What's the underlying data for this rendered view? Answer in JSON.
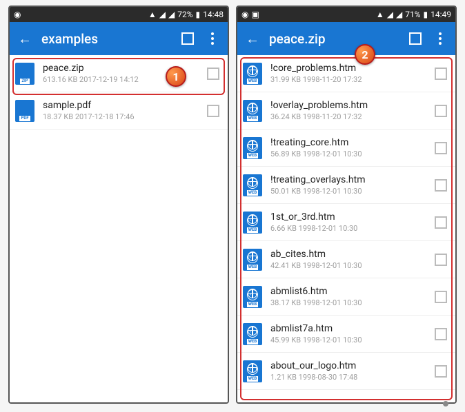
{
  "left": {
    "statusbar": {
      "battery": "72%",
      "time": "14:48"
    },
    "title": "examples",
    "files": [
      {
        "name": "peace.zip",
        "meta": "613.16 KB 2017-12-19 14:12",
        "ext": "ZIP"
      },
      {
        "name": "sample.pdf",
        "meta": "18.37 KB 2017-12-18 17:46",
        "ext": "PDF"
      }
    ],
    "badge": "1"
  },
  "right": {
    "statusbar": {
      "battery": "71%",
      "time": "14:49"
    },
    "title": "peace.zip",
    "files": [
      {
        "name": "!core_problems.htm",
        "meta": "31.99 KB 1998-11-20 17:32",
        "ext": "WEB"
      },
      {
        "name": "!overlay_problems.htm",
        "meta": "36.24 KB 1998-11-20 17:32",
        "ext": "WEB"
      },
      {
        "name": "!treating_core.htm",
        "meta": "56.89 KB 1998-12-01 10:30",
        "ext": "WEB"
      },
      {
        "name": "!treating_overlays.htm",
        "meta": "50.01 KB 1998-12-01 10:30",
        "ext": "WEB"
      },
      {
        "name": "1st_or_3rd.htm",
        "meta": "6.66 KB 1998-12-01 10:30",
        "ext": "WEB"
      },
      {
        "name": "ab_cites.htm",
        "meta": "42.41 KB 1998-12-01 10:30",
        "ext": "WEB"
      },
      {
        "name": "abmlist6.htm",
        "meta": "38.17 KB 1998-12-01 10:30",
        "ext": "WEB"
      },
      {
        "name": "abmlist7a.htm",
        "meta": "45.99 KB 1998-12-01 10:30",
        "ext": "WEB"
      },
      {
        "name": "about_our_logo.htm",
        "meta": "1.21 KB 1998-08-30 17:48",
        "ext": "WEB"
      }
    ],
    "badge": "2"
  }
}
